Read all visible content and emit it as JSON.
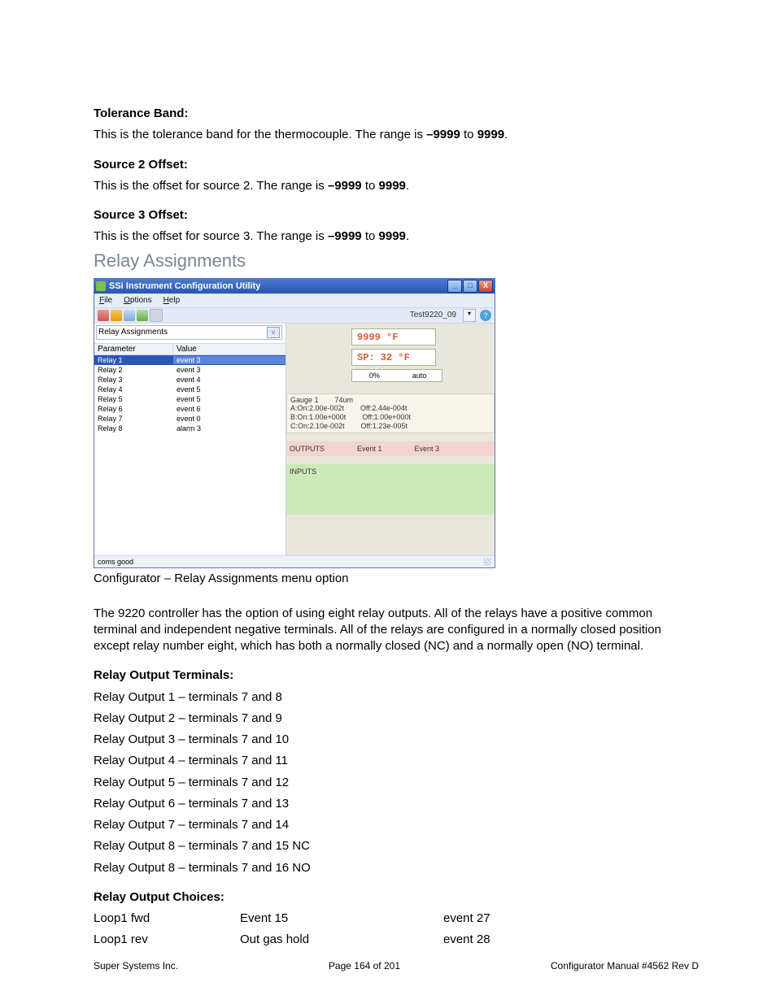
{
  "tolerance": {
    "heading": "Tolerance Band:",
    "line_a": "This is the tolerance band for the thermocouple.  The range is ",
    "range_low": "–9999",
    "range_mid": " to ",
    "range_high": "9999",
    "tail": "."
  },
  "src2": {
    "heading": "Source 2 Offset:",
    "line_a": "This is the offset for source 2.  The range is ",
    "range_low": "–9999",
    "range_mid": " to ",
    "range_high": "9999",
    "tail": "."
  },
  "src3": {
    "heading": "Source 3 Offset:",
    "line_a": "This is the offset for source 3.  The range is ",
    "range_low": "–9999",
    "range_mid": " to ",
    "range_high": "9999",
    "tail": "."
  },
  "section_heading": "Relay Assignments",
  "win": {
    "title": "SSi Instrument Configuration Utility",
    "menu": {
      "file": "File",
      "options": "Options",
      "help": "Help"
    },
    "toolbar_label": "Test9220_09",
    "dropdown": "Relay Assignments",
    "grid": {
      "h1": "Parameter",
      "h2": "Value",
      "rows": [
        {
          "p": "Relay 1",
          "v": "event 3"
        },
        {
          "p": "Relay 2",
          "v": "event 3"
        },
        {
          "p": "Relay 3",
          "v": "event 4"
        },
        {
          "p": "Relay 4",
          "v": "event 5"
        },
        {
          "p": "Relay 5",
          "v": "event 5"
        },
        {
          "p": "Relay 6",
          "v": "event 6"
        },
        {
          "p": "Relay 7",
          "v": "event 0"
        },
        {
          "p": "Relay 8",
          "v": "alarm 3"
        }
      ]
    },
    "led": {
      "temp": "9999 °F",
      "sp": "SP: 32 °F",
      "pct": "0%",
      "mode": "auto"
    },
    "gauge": {
      "title": "Gauge 1",
      "um": "74um",
      "a_on": "A:On:2.00e-002t",
      "a_off": "Off:2.44e-004t",
      "b_on": "B:On:1.00e+000t",
      "b_off": "Off:1.00e+000t",
      "c_on": "C:On:2.10e-002t",
      "c_off": "Off:1.23e-005t"
    },
    "outputs": {
      "label": "OUTPUTS",
      "e1": "Event 1",
      "e3": "Event 3"
    },
    "inputs": {
      "label": "INPUTS"
    },
    "status": "coms good",
    "winbtns": {
      "min": "_",
      "max": "□",
      "close": "X"
    }
  },
  "caption": "Configurator – Relay Assignments menu option",
  "body": {
    "p1": "The 9220 controller has the option of using eight relay outputs. All of the relays have a positive common terminal and independent negative terminals. All of the relays are configured in a normally closed position except relay number eight, which has both a normally closed (NC) and a normally open (NO) terminal."
  },
  "terminals": {
    "heading": "Relay Output Terminals:",
    "lines": [
      "Relay Output 1 – terminals 7 and 8",
      "Relay Output 2 – terminals 7 and 9",
      "Relay Output 3 – terminals 7 and 10",
      "Relay Output 4 – terminals 7 and 11",
      "Relay Output 5 – terminals 7 and 12",
      "Relay Output 6 – terminals 7 and 13",
      "Relay Output 7 – terminals 7 and 14",
      "Relay Output 8 – terminals 7 and 15 NC",
      "Relay Output 8 – terminals 7 and 16 NO"
    ]
  },
  "choices": {
    "heading": "Relay Output Choices:",
    "col1": [
      "Loop1 fwd",
      "Loop1 rev"
    ],
    "col2": [
      "Event 15",
      "Out gas hold"
    ],
    "col3": [
      "event 27",
      "event 28"
    ]
  },
  "footer": {
    "left": "Super Systems Inc.",
    "center": "Page 164 of 201",
    "right": "Configurator Manual #4562 Rev D"
  }
}
